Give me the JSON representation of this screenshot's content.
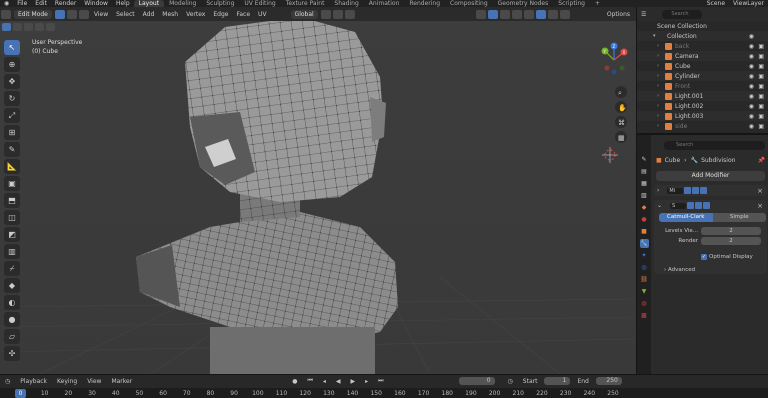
{
  "topbar": {
    "menus": [
      "File",
      "Edit",
      "Render",
      "Window",
      "Help"
    ],
    "workspaces": [
      "Layout",
      "Modeling",
      "Sculpting",
      "UV Editing",
      "Texture Paint",
      "Shading",
      "Animation",
      "Rendering",
      "Compositing",
      "Geometry Nodes",
      "Scripting"
    ],
    "active_workspace": "Layout",
    "add_tab": "+",
    "scene": "Scene",
    "view_layer": "ViewLayer"
  },
  "viewport": {
    "mode": "Edit Mode",
    "menus": [
      "View",
      "Select",
      "Add",
      "Mesh",
      "Vertex",
      "Edge",
      "Face",
      "UV"
    ],
    "transform_orientation": "Global",
    "options": "Options",
    "perspective": "User Perspective",
    "object": "(0) Cube",
    "gizmo": {
      "x": "X",
      "y": "Y",
      "z": "Z"
    }
  },
  "outliner": {
    "search_placeholder": "Search",
    "root": "Scene Collection",
    "collection": "Collection",
    "items": [
      {
        "name": "back",
        "dim": true
      },
      {
        "name": "Camera",
        "dim": false
      },
      {
        "name": "Cube",
        "dim": false
      },
      {
        "name": "Cylinder",
        "dim": false
      },
      {
        "name": "Front",
        "dim": true
      },
      {
        "name": "Light.001",
        "dim": false
      },
      {
        "name": "Light.002",
        "dim": false
      },
      {
        "name": "Light.003",
        "dim": false
      },
      {
        "name": "side",
        "dim": true
      }
    ]
  },
  "properties": {
    "search_placeholder": "Search",
    "object": "Cube",
    "modifier_context": "Subdivision",
    "add_modifier": "Add Modifier",
    "modifiers": [
      {
        "name": "Mi",
        "expanded": false
      },
      {
        "name": "S",
        "expanded": true
      }
    ],
    "subdivision": {
      "algorithms": [
        "Catmull-Clark",
        "Simple"
      ],
      "active_algorithm": "Catmull-Clark",
      "levels_viewport_label": "Levels Vie...",
      "levels_viewport": "2",
      "render_label": "Render",
      "render": "2",
      "optimal_display_label": "Optimal Display",
      "optimal_display": true,
      "advanced": "Advanced"
    }
  },
  "timeline": {
    "menus": [
      "Playback",
      "Keying",
      "View",
      "Marker"
    ],
    "current_frame": "0",
    "start_label": "Start",
    "start": "1",
    "end_label": "End",
    "end": "250",
    "ruler": [
      "0",
      "10",
      "20",
      "30",
      "40",
      "50",
      "60",
      "70",
      "80",
      "90",
      "100",
      "110",
      "120",
      "130",
      "140",
      "150",
      "160",
      "170",
      "180",
      "190",
      "200",
      "210",
      "220",
      "230",
      "240",
      "250"
    ]
  }
}
